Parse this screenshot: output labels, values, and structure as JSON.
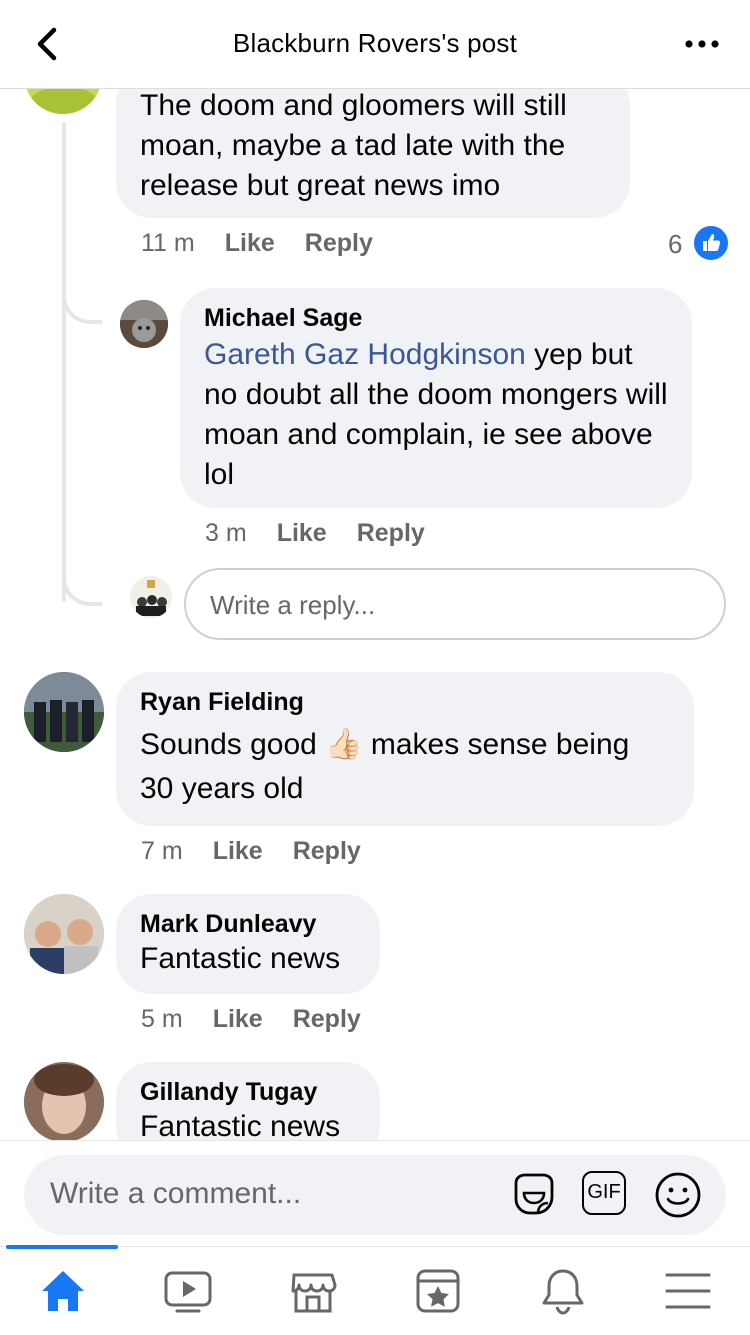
{
  "header": {
    "title": "Blackburn Rovers's post"
  },
  "comments": {
    "c0": {
      "text": "The doom and gloomers will still moan, maybe a tad late with the release but great news imo",
      "time": "11 m",
      "like": "Like",
      "reply": "Reply",
      "reaction_count": "6"
    },
    "c0_reply": {
      "author": "Michael Sage",
      "mention": "Gareth Gaz Hodgkinson",
      "text": " yep but no doubt all the doom mongers will moan and complain, ie see above lol",
      "time": "3 m",
      "like": "Like",
      "reply": "Reply"
    },
    "reply_input_placeholder": "Write a reply...",
    "c1": {
      "author": "Ryan Fielding",
      "text_before": "Sounds good ",
      "emoji": "👍🏻",
      "text_after": " makes sense being 30 years old",
      "time": "7 m",
      "like": "Like",
      "reply": "Reply"
    },
    "c2": {
      "author": "Mark Dunleavy",
      "text": "Fantastic news",
      "time": "5 m",
      "like": "Like",
      "reply": "Reply"
    },
    "c3": {
      "author": "Gillandy Tugay",
      "text": "Fantastic news"
    }
  },
  "composer": {
    "placeholder": "Write a comment...",
    "gif_label": "GIF"
  },
  "tabs": [
    "home-icon",
    "watch-icon",
    "marketplace-icon",
    "pages-icon",
    "notifications-icon",
    "menu-icon"
  ],
  "colors": {
    "accent": "#1877f2",
    "bubble": "#f0f2f5",
    "muted": "#65676b",
    "mention": "#385898"
  }
}
